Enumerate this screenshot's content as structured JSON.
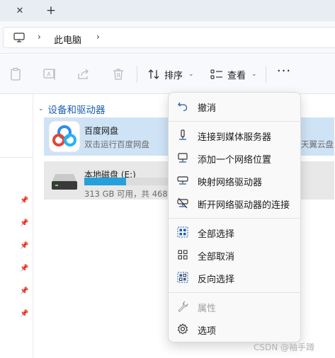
{
  "tabs": {
    "close_glyph": "✕",
    "new_glyph": "+"
  },
  "address": {
    "separator": "›",
    "crumb": "此电脑"
  },
  "toolbar": {
    "sort_label": "排序",
    "view_label": "查看",
    "more_label": "···",
    "caret": "⌄"
  },
  "content": {
    "section_title": "设备和驱动器",
    "drives": [
      {
        "name": "百度网盘",
        "subtitle": "双击运行百度网盘"
      },
      {
        "name": "本地磁盘 (E:)",
        "subtitle": "313 GB 可用，共 468 GB",
        "used_fraction": 0.33
      }
    ],
    "right_partial": "天翼云盘"
  },
  "menu": {
    "items": [
      {
        "label": "撤消",
        "icon": "undo-icon"
      },
      {
        "label": "连接到媒体服务器",
        "icon": "media-server-icon"
      },
      {
        "label": "添加一个网络位置",
        "icon": "network-location-icon"
      },
      {
        "label": "映射网络驱动器",
        "icon": "map-drive-icon"
      },
      {
        "label": "断开网络驱动器的连接",
        "icon": "disconnect-drive-icon"
      },
      {
        "label": "全部选择",
        "icon": "select-all-icon"
      },
      {
        "label": "全部取消",
        "icon": "select-none-icon"
      },
      {
        "label": "反向选择",
        "icon": "invert-selection-icon"
      },
      {
        "label": "属性",
        "icon": "wrench-icon",
        "disabled": true
      },
      {
        "label": "选项",
        "icon": "gear-icon"
      }
    ]
  },
  "watermark": "CSDN @袖手蹲",
  "colors": {
    "accent": "#1b5fb0",
    "storage_fill": "#26a0da",
    "selection": "#cfe3f6"
  }
}
